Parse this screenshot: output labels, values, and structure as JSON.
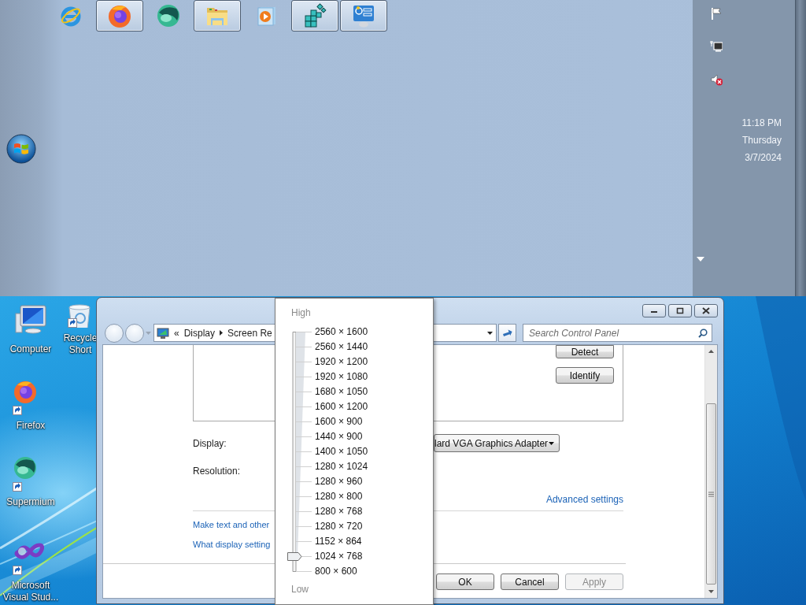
{
  "taskbar": {
    "buttons": [
      {
        "kind": "ie",
        "running": false
      },
      {
        "kind": "firefox",
        "running": true
      },
      {
        "kind": "supermium",
        "running": false
      },
      {
        "kind": "explorer",
        "running": true
      },
      {
        "kind": "media",
        "running": false
      },
      {
        "kind": "regedit",
        "running": true
      },
      {
        "kind": "controlpanel",
        "running": true
      }
    ],
    "tray": [
      {
        "kind": "flag"
      },
      {
        "kind": "network"
      },
      {
        "kind": "volume-muted"
      }
    ],
    "clock": {
      "time": "11:18 PM",
      "day": "Thursday",
      "date": "3/7/2024"
    }
  },
  "desktop_icons": [
    {
      "kind": "computer",
      "label": "Computer",
      "shortcut": false
    },
    {
      "kind": "recycle",
      "label": "Recycle Short",
      "shortcut": true
    },
    {
      "kind": "firefox",
      "label": "Firefox",
      "shortcut": true
    },
    {
      "kind": "supermium",
      "label": "Supermium",
      "shortcut": true
    },
    {
      "kind": "vs",
      "label": "Microsoft Visual Stud...",
      "shortcut": true
    }
  ],
  "window": {
    "address": {
      "prefix": "«",
      "crumbs": [
        "Display",
        "Screen Re"
      ]
    },
    "search": {
      "placeholder": "Search Control Panel"
    },
    "monitor_buttons": [
      "Detect",
      "Identify"
    ],
    "display": {
      "label": "Display:",
      "value": "lard VGA Graphics Adapter"
    },
    "resolution": {
      "label": "Resolution:"
    },
    "advanced_link": "Advanced settings",
    "links": [
      "Make text and other",
      "What display setting"
    ],
    "buttons": [
      {
        "label": "OK",
        "disabled": false
      },
      {
        "label": "Cancel",
        "disabled": false
      },
      {
        "label": "Apply",
        "disabled": true
      }
    ]
  },
  "resolution_popup": {
    "high_label": "High",
    "low_label": "Low",
    "level": 0.0625,
    "options": [
      "2560 × 1600",
      "2560 × 1440",
      "1920 × 1200",
      "1920 × 1080",
      "1680 × 1050",
      "1600 × 1200",
      "1600 × 900",
      "1440 × 900",
      "1400 × 1050",
      "1280 × 1024",
      "1280 × 960",
      "1280 × 800",
      "1280 × 768",
      "1280 × 720",
      "1152 × 864",
      "1024 × 768",
      "800 × 600"
    ]
  }
}
